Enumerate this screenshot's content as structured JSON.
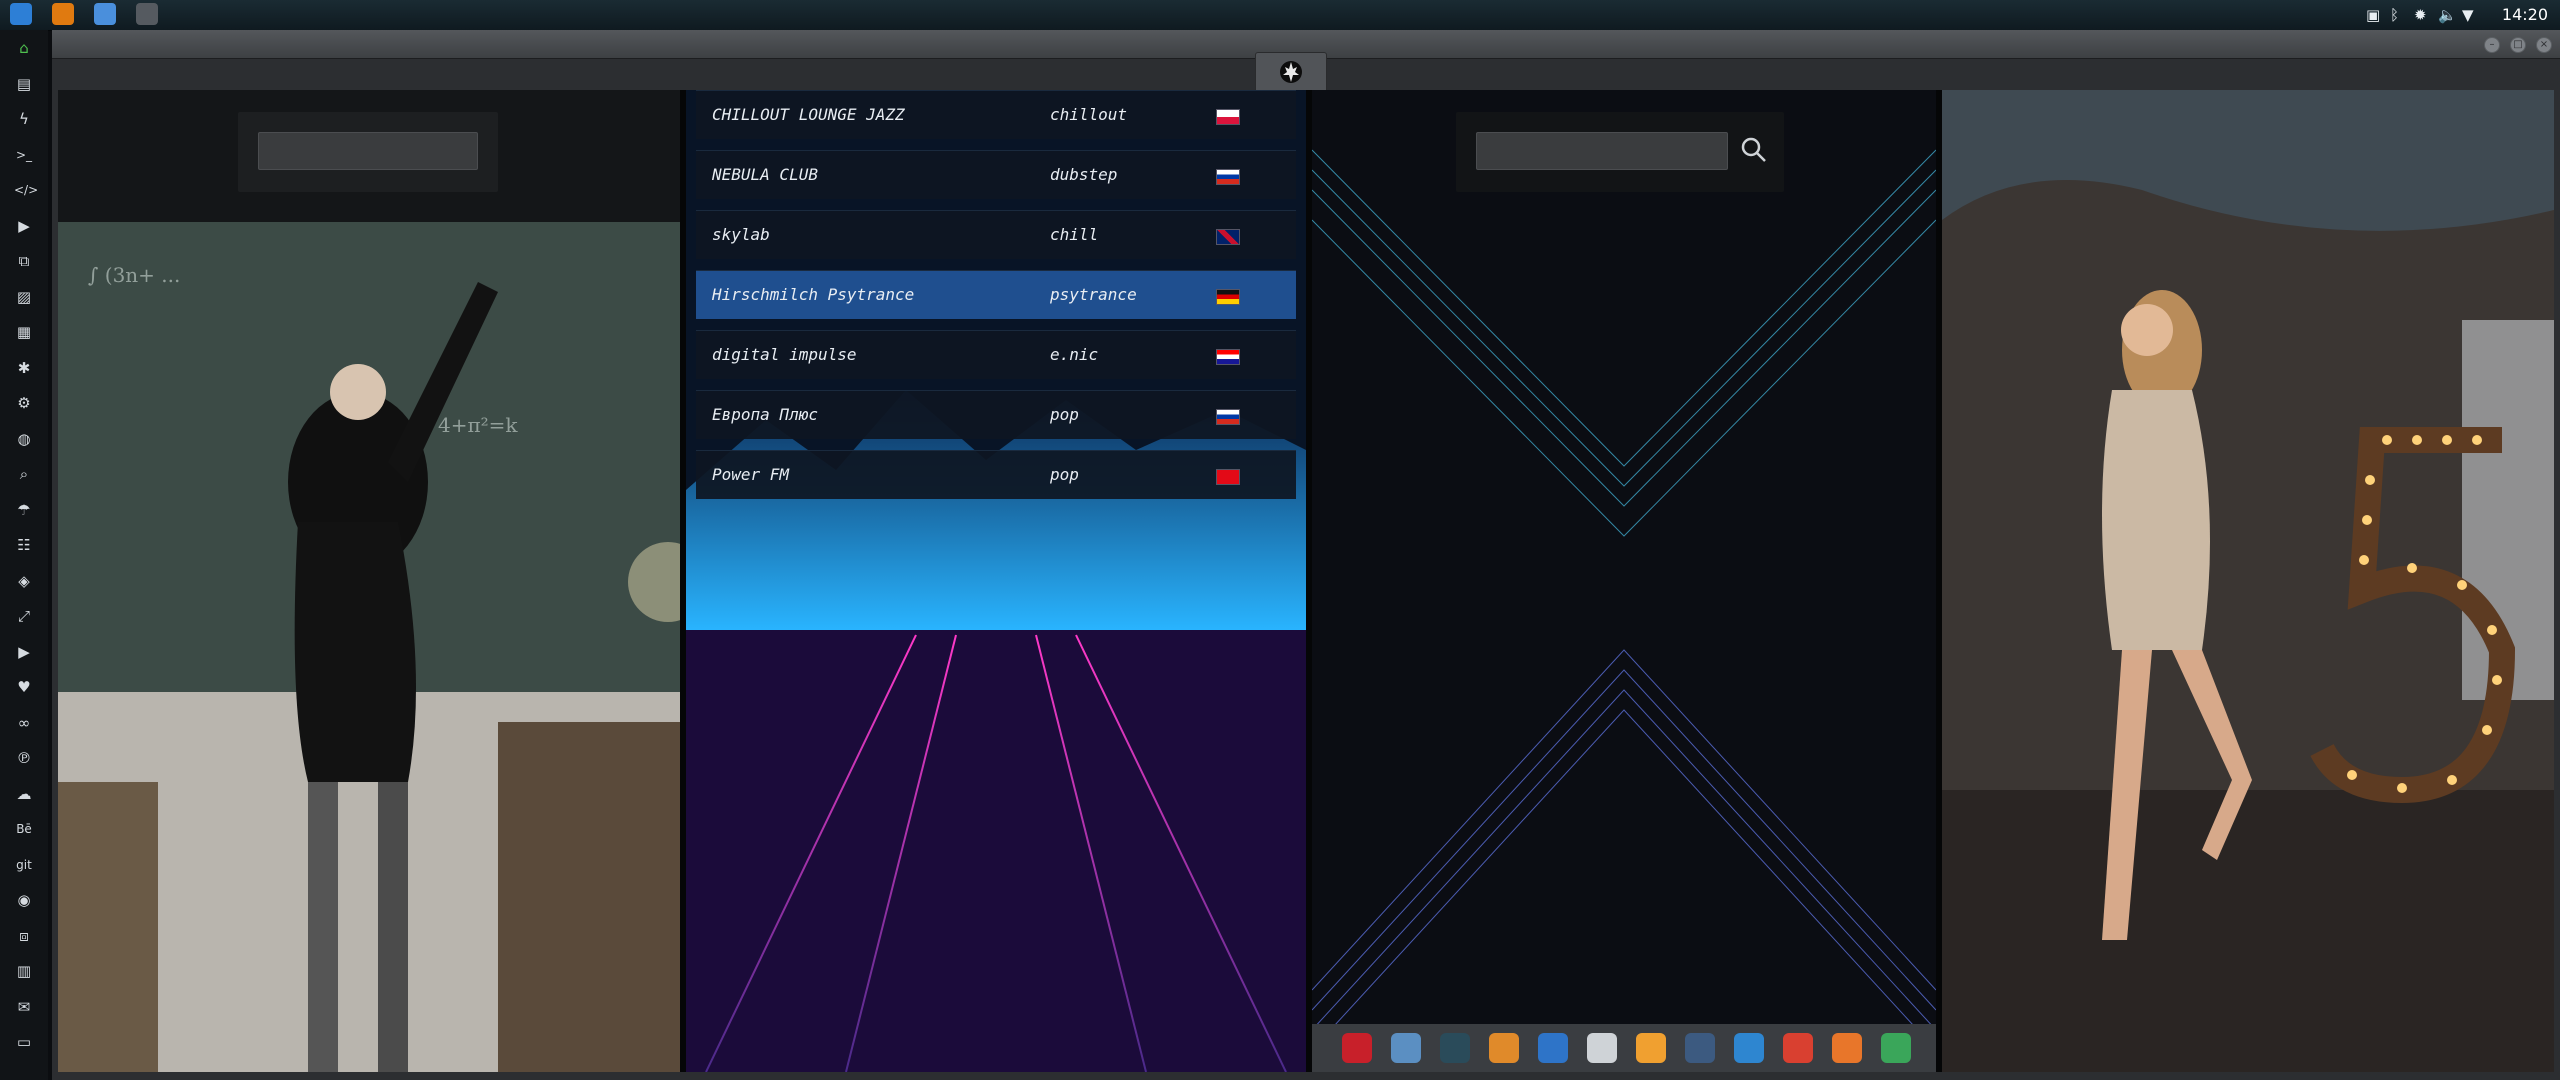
{
  "topbar": {
    "clock": "14:20",
    "apps": [
      {
        "icon": "files-icon",
        "color": "#2d7fd6"
      },
      {
        "icon": "sublime-icon",
        "color": "#e07a10"
      },
      {
        "icon": "chrome-icon",
        "color": "#4a8fdc"
      },
      {
        "icon": "window-icon",
        "color": "#555a60"
      }
    ],
    "tray": [
      {
        "icon": "photo-tray-icon",
        "glyph": "▣"
      },
      {
        "icon": "bluetooth-icon",
        "glyph": "ᛒ"
      },
      {
        "icon": "bug-icon",
        "glyph": "✹"
      },
      {
        "icon": "volume-icon",
        "glyph": "🔈"
      },
      {
        "icon": "wifi-icon",
        "glyph": "▼"
      }
    ]
  },
  "launcher": {
    "items": [
      {
        "icon": "home-icon",
        "glyph": "⌂",
        "color": "#4fc04f"
      },
      {
        "icon": "document-icon",
        "glyph": "▤"
      },
      {
        "icon": "lightning-icon",
        "glyph": "ϟ"
      },
      {
        "icon": "terminal-icon",
        "glyph": ">_"
      },
      {
        "icon": "code-icon",
        "glyph": "</>"
      },
      {
        "icon": "play-icon",
        "glyph": "▶"
      },
      {
        "icon": "copy-icon",
        "glyph": "⧉"
      },
      {
        "icon": "image-icon",
        "glyph": "▨"
      },
      {
        "icon": "news-icon",
        "glyph": "▦"
      },
      {
        "icon": "aperture-icon",
        "glyph": "✱"
      },
      {
        "icon": "settings-icon",
        "glyph": "⚙"
      },
      {
        "icon": "globe-icon",
        "glyph": "◍"
      },
      {
        "icon": "search-icon",
        "glyph": "⌕"
      },
      {
        "icon": "umbrella-icon",
        "glyph": "☂"
      },
      {
        "icon": "contact-icon",
        "glyph": "☷"
      },
      {
        "icon": "tag-icon",
        "glyph": "◈"
      },
      {
        "icon": "expand-icon",
        "glyph": "⤢"
      },
      {
        "icon": "youtube-icon",
        "glyph": "▶"
      },
      {
        "icon": "heart-icon",
        "glyph": "♥"
      },
      {
        "icon": "infinity-icon",
        "glyph": "∞"
      },
      {
        "icon": "pinterest-icon",
        "glyph": "℗"
      },
      {
        "icon": "cloud-icon",
        "glyph": "☁"
      },
      {
        "icon": "behance-icon",
        "glyph": "Bē"
      },
      {
        "icon": "git-icon",
        "glyph": "git"
      },
      {
        "icon": "github-icon",
        "glyph": "◉"
      },
      {
        "icon": "cubes-icon",
        "glyph": "⧈"
      },
      {
        "icon": "map-icon",
        "glyph": "▥"
      },
      {
        "icon": "mail-icon",
        "glyph": "✉"
      },
      {
        "icon": "inbox-icon",
        "glyph": "▭"
      }
    ]
  },
  "window": {
    "tab_icon": "rebel-alliance-icon",
    "controls": [
      "minimize",
      "maximize",
      "close"
    ]
  },
  "radio": {
    "stations": [
      {
        "name": "CHILLOUT LOUNGE JAZZ",
        "genre": "chillout",
        "flag": "poland-flag",
        "selected": false
      },
      {
        "name": "NEBULA CLUB",
        "genre": "dubstep",
        "flag": "russia-flag",
        "selected": false
      },
      {
        "name": "skylab",
        "genre": "chill",
        "flag": "uk-flag",
        "selected": false
      },
      {
        "name": "Hirschmilch Psytrance",
        "genre": "psytrance",
        "flag": "germany-flag",
        "selected": true
      },
      {
        "name": "digital impulse",
        "genre": "e.nic",
        "flag": "croatia-flag",
        "selected": false
      },
      {
        "name": "Европа Плюс",
        "genre": "pop",
        "flag": "russia-flag",
        "selected": false
      },
      {
        "name": "Power FM",
        "genre": "pop",
        "flag": "turkey-flag",
        "selected": false
      }
    ]
  },
  "dock": {
    "items": [
      {
        "icon": "adobe-icon",
        "color": "#c8202a"
      },
      {
        "icon": "text-editor-icon",
        "color": "#5b8fc2"
      },
      {
        "icon": "globe-dark-icon",
        "color": "#2a4b5a"
      },
      {
        "icon": "photos-icon",
        "color": "#e08a2a"
      },
      {
        "icon": "translate-icon",
        "color": "#2e74c8"
      },
      {
        "icon": "notes-icon",
        "color": "#cfd3d7"
      },
      {
        "icon": "search-app-icon",
        "color": "#f0a030"
      },
      {
        "icon": "clock-app-icon",
        "color": "#3c5a80"
      },
      {
        "icon": "browser-icon",
        "color": "#2e86d0"
      },
      {
        "icon": "calendar-icon",
        "color": "#d94030"
      },
      {
        "icon": "arrow-app-icon",
        "color": "#e8762a"
      },
      {
        "icon": "yandex-icon",
        "color": "#3aa65a"
      }
    ]
  }
}
